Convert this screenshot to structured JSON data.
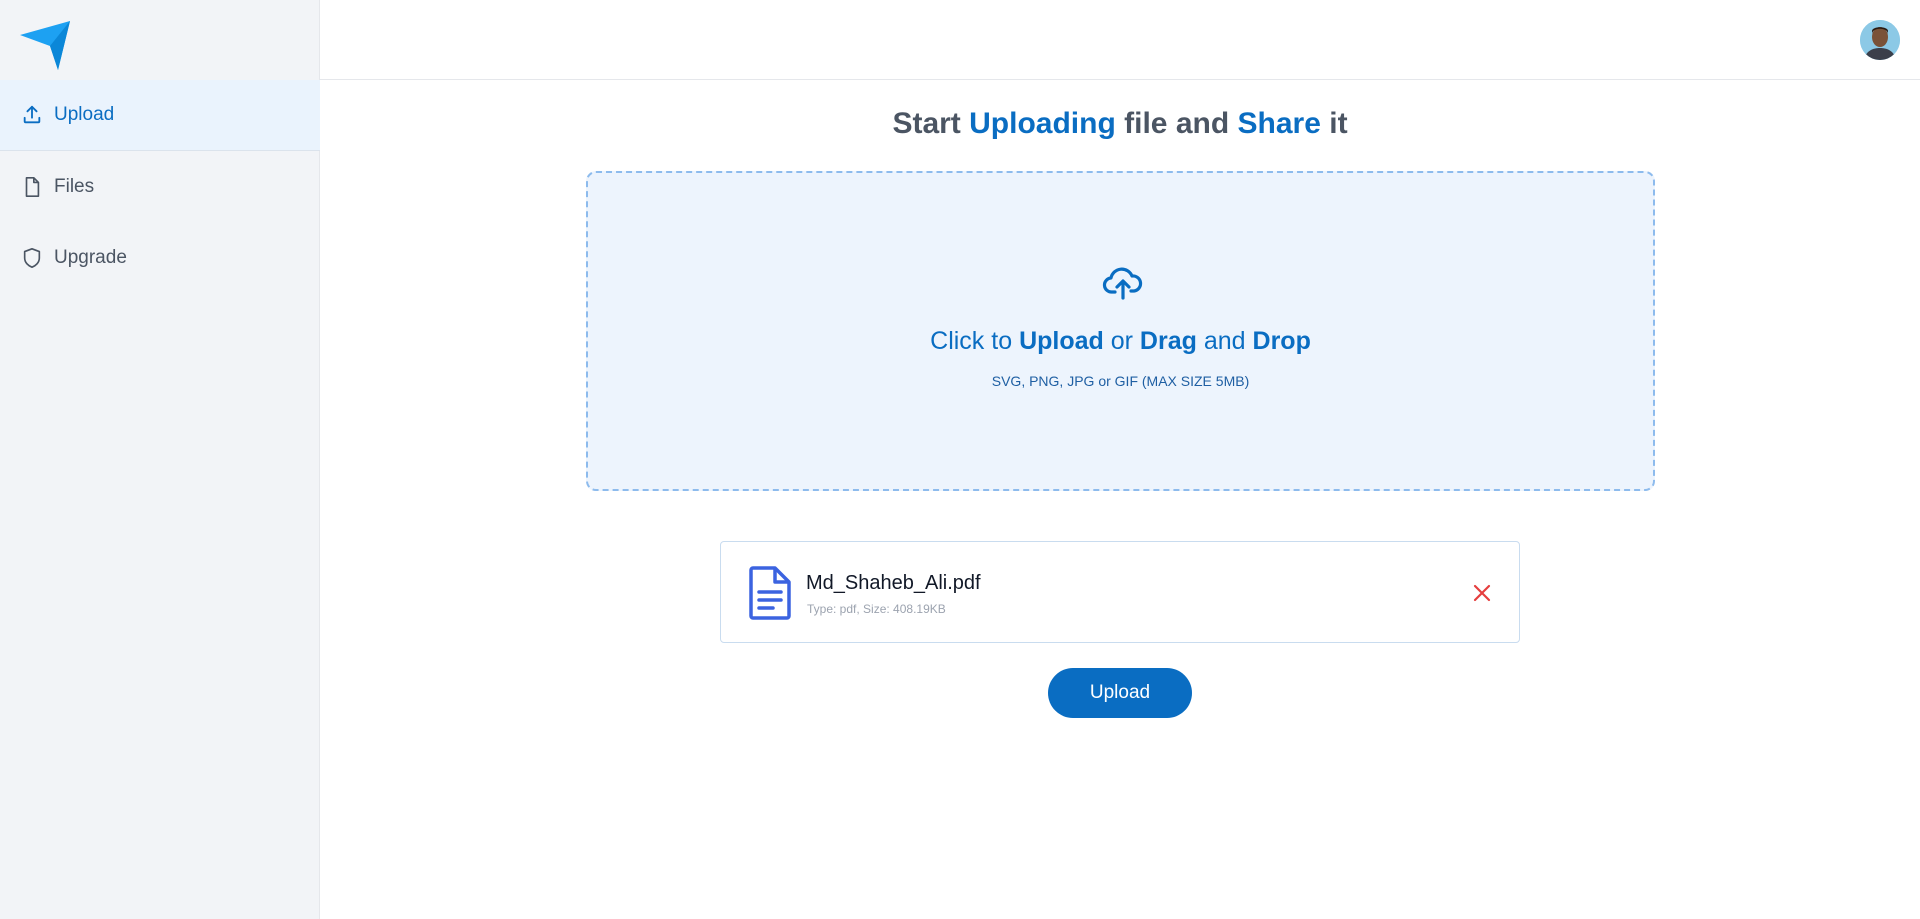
{
  "sidebar": {
    "items": [
      {
        "label": "Upload",
        "icon": "upload-icon",
        "active": true
      },
      {
        "label": "Files",
        "icon": "file-icon",
        "active": false
      },
      {
        "label": "Upgrade",
        "icon": "shield-icon",
        "active": false
      }
    ]
  },
  "header": {
    "heading_start": "Start",
    "heading_uploading": "Uploading",
    "heading_file_and": "file and",
    "heading_share": "Share",
    "heading_it": "it"
  },
  "dropzone": {
    "icon": "cloud-upload-icon",
    "click_to": "Click to",
    "upload": "Upload",
    "or": "or",
    "drag": "Drag",
    "and": "and",
    "drop": "Drop",
    "hint": "SVG, PNG, JPG or GIF (MAX SIZE 5MB)"
  },
  "file": {
    "name": "Md_Shaheb_Ali.pdf",
    "meta": "Type: pdf, Size: 408.19KB",
    "icon": "document-icon",
    "remove_icon": "close-icon"
  },
  "actions": {
    "upload_label": "Upload"
  },
  "colors": {
    "accent": "#0a6dc2",
    "logo": "#1da1f2",
    "remove": "#e53e3e",
    "dropzone_bg": "#edf4fd"
  }
}
